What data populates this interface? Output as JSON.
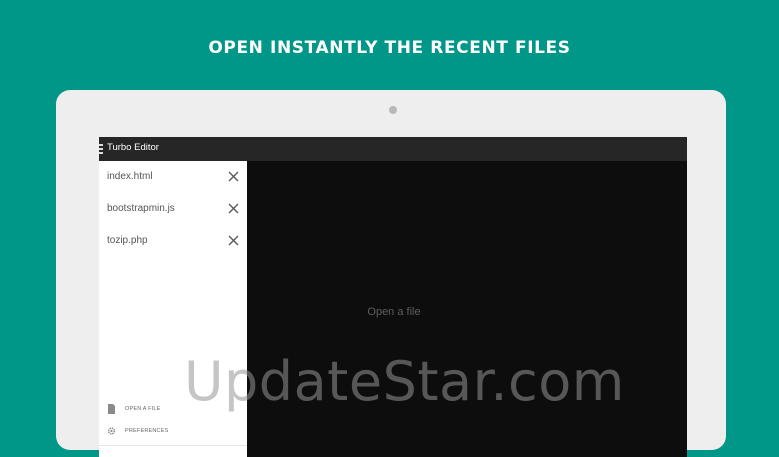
{
  "promo": {
    "headline": "OPEN INSTANTLY THE RECENT FILES"
  },
  "app": {
    "title": "Turbo Editor",
    "menu_icon": "hamburger-menu-icon"
  },
  "drawer": {
    "recent_files": [
      {
        "name": "index.html",
        "icon": "close-icon"
      },
      {
        "name": "bootstrapmin.js",
        "icon": "close-icon"
      },
      {
        "name": "tozip.php",
        "icon": "close-icon"
      }
    ],
    "actions": [
      {
        "label": "OPEN A FILE",
        "icon": "file-icon"
      },
      {
        "label": "PREFERENCES",
        "icon": "gear-icon"
      }
    ]
  },
  "editor": {
    "placeholder": "Open a file"
  },
  "watermark": {
    "text": "UpdateStar.com"
  },
  "colors": {
    "background": "#009688",
    "device": "#eeeeee",
    "screen": "#0d0d0d",
    "app_bar": "#262626",
    "drawer": "#ffffff"
  }
}
